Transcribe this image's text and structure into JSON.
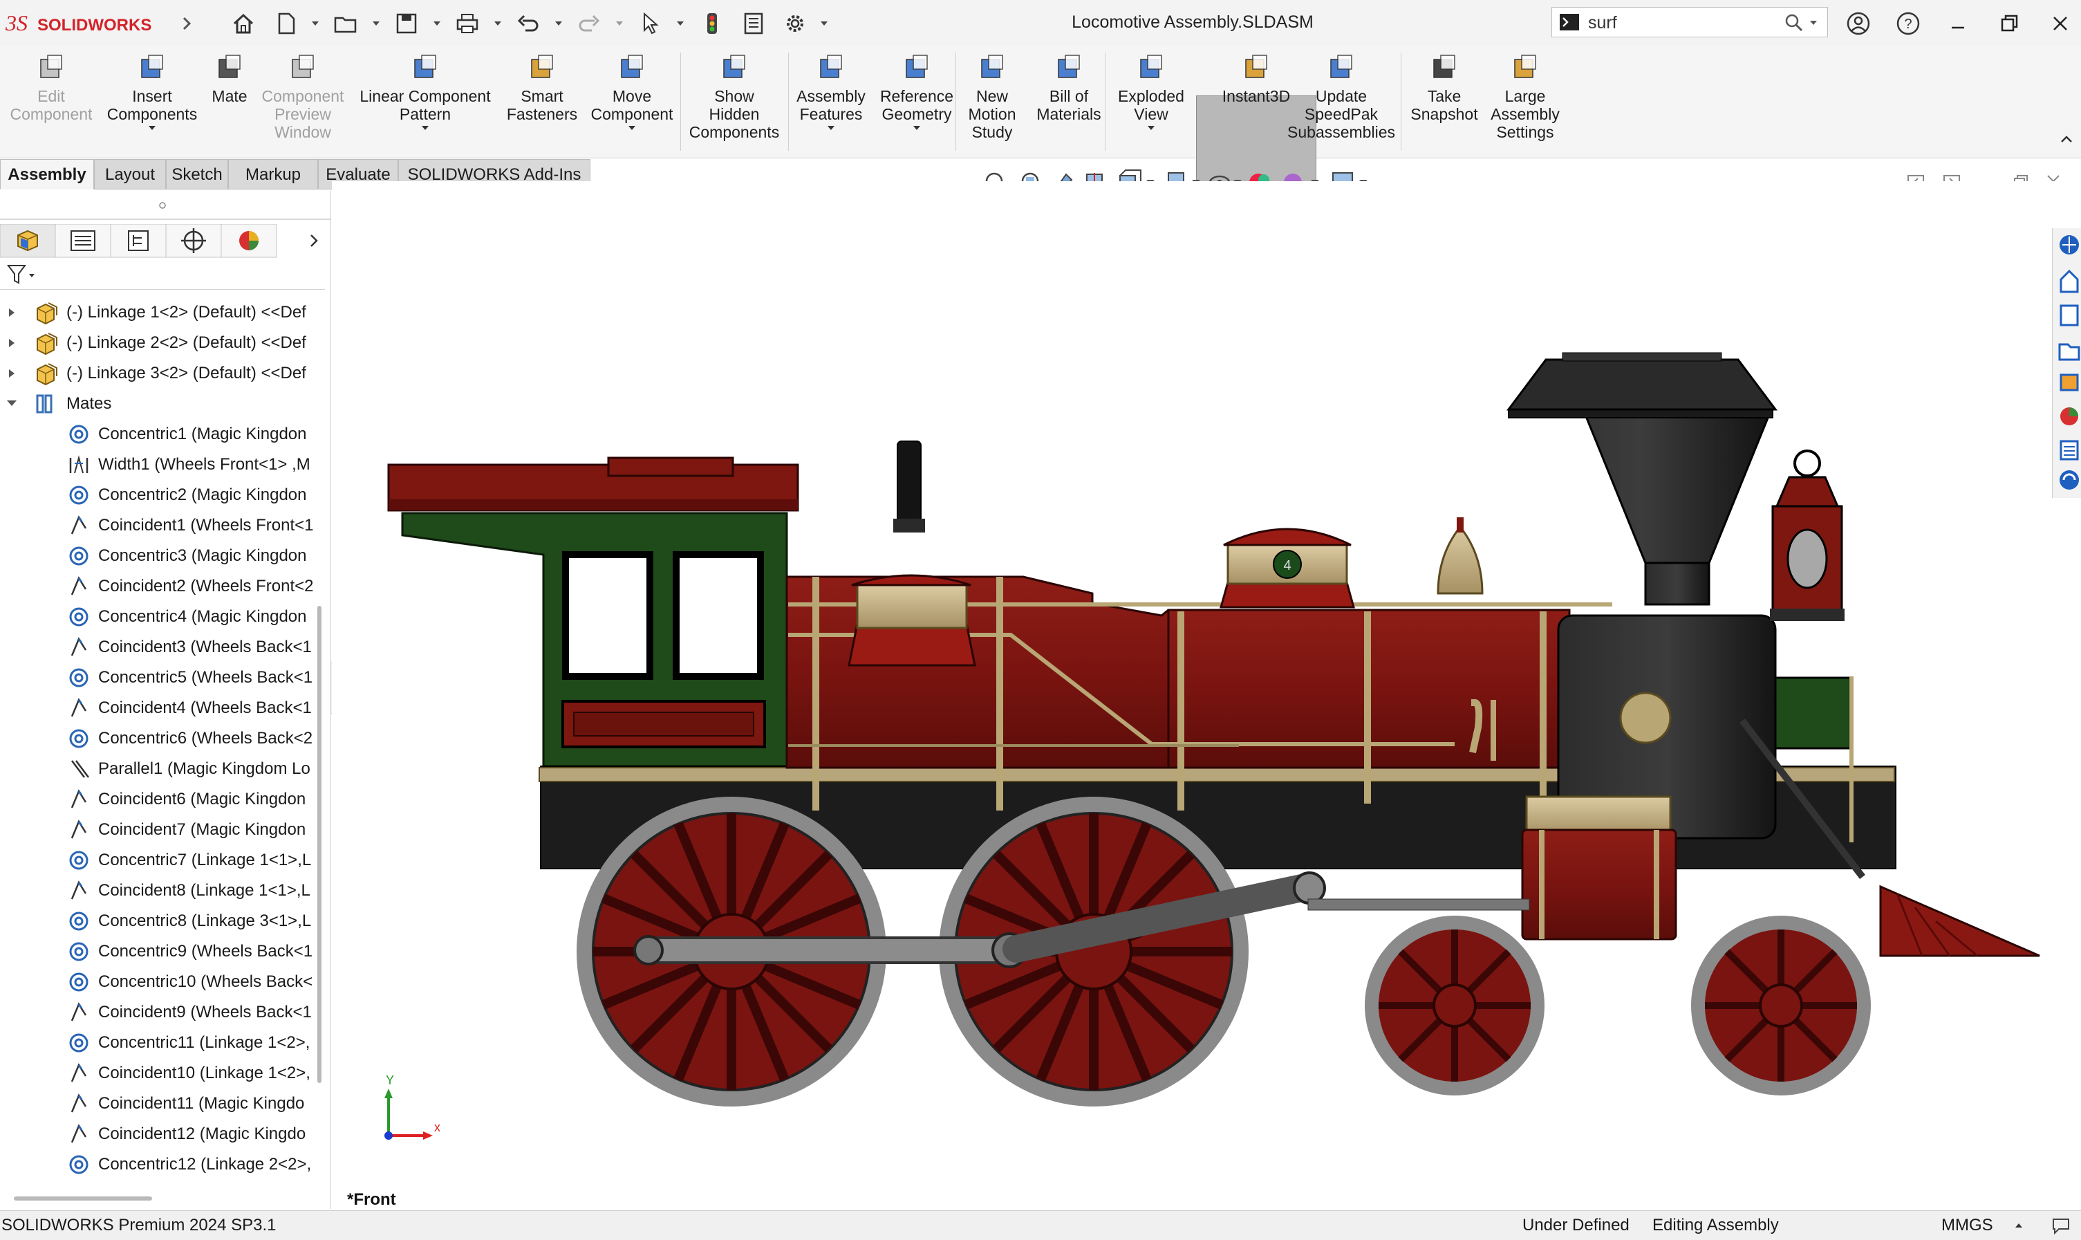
{
  "app": {
    "name": "SOLIDWORKS",
    "document_title": "Locomotive Assembly.SLDASM"
  },
  "search": {
    "value": "surf"
  },
  "commands": [
    {
      "id": "edit-component",
      "label": "Edit\nComponent",
      "disabled": true
    },
    {
      "id": "insert-components",
      "label": "Insert\nComponents"
    },
    {
      "id": "mate",
      "label": "Mate"
    },
    {
      "id": "component-preview-window",
      "label": "Component\nPreview\nWindow",
      "disabled": true
    },
    {
      "id": "linear-component-pattern",
      "label": "Linear Component\nPattern"
    },
    {
      "id": "smart-fasteners",
      "label": "Smart\nFasteners"
    },
    {
      "id": "move-component",
      "label": "Move\nComponent"
    },
    {
      "id": "show-hidden-components",
      "label": "Show\nHidden\nComponents"
    },
    {
      "id": "assembly-features",
      "label": "Assembly\nFeatures"
    },
    {
      "id": "reference-geometry",
      "label": "Reference\nGeometry"
    },
    {
      "id": "new-motion-study",
      "label": "New\nMotion\nStudy"
    },
    {
      "id": "bill-of-materials",
      "label": "Bill of\nMaterials"
    },
    {
      "id": "exploded-view",
      "label": "Exploded\nView"
    },
    {
      "id": "instant3d",
      "label": "Instant3D",
      "active": true
    },
    {
      "id": "update-speedpak",
      "label": "Update\nSpeedPak\nSubassemblies"
    },
    {
      "id": "take-snapshot",
      "label": "Take\nSnapshot"
    },
    {
      "id": "large-assembly-settings",
      "label": "Large\nAssembly\nSettings"
    }
  ],
  "tabs": [
    "Assembly",
    "Layout",
    "Sketch",
    "Markup",
    "Evaluate",
    "SOLIDWORKS Add-Ins"
  ],
  "active_tab": "Assembly",
  "tree": {
    "components": [
      "(-) Linkage 1<2> (Default) <<Def",
      "(-) Linkage 2<2> (Default) <<Def",
      "(-) Linkage 3<2> (Default) <<Def"
    ],
    "mates_folder": "Mates",
    "mates": [
      {
        "type": "concentric",
        "label": "Concentric1 (Magic Kingdon"
      },
      {
        "type": "width",
        "label": "Width1 (Wheels Front<1> ,M"
      },
      {
        "type": "concentric",
        "label": "Concentric2 (Magic Kingdon"
      },
      {
        "type": "coincident",
        "label": "Coincident1 (Wheels Front<1"
      },
      {
        "type": "concentric",
        "label": "Concentric3 (Magic Kingdon"
      },
      {
        "type": "coincident",
        "label": "Coincident2 (Wheels Front<2"
      },
      {
        "type": "concentric",
        "label": "Concentric4 (Magic Kingdon"
      },
      {
        "type": "coincident",
        "label": "Coincident3 (Wheels Back<1"
      },
      {
        "type": "concentric",
        "label": "Concentric5 (Wheels Back<1"
      },
      {
        "type": "coincident",
        "label": "Coincident4 (Wheels Back<1"
      },
      {
        "type": "concentric",
        "label": "Concentric6 (Wheels Back<2"
      },
      {
        "type": "parallel",
        "label": "Parallel1 (Magic Kingdom Lo"
      },
      {
        "type": "coincident",
        "label": "Coincident6 (Magic Kingdon"
      },
      {
        "type": "coincident",
        "label": "Coincident7 (Magic Kingdon"
      },
      {
        "type": "concentric",
        "label": "Concentric7 (Linkage 1<1>,L"
      },
      {
        "type": "coincident",
        "label": "Coincident8 (Linkage 1<1>,L"
      },
      {
        "type": "concentric",
        "label": "Concentric8 (Linkage 3<1>,L"
      },
      {
        "type": "concentric",
        "label": "Concentric9 (Wheels Back<1"
      },
      {
        "type": "concentric",
        "label": "Concentric10 (Wheels Back<"
      },
      {
        "type": "coincident",
        "label": "Coincident9 (Wheels Back<1"
      },
      {
        "type": "concentric",
        "label": "Concentric11 (Linkage 1<2>,"
      },
      {
        "type": "coincident",
        "label": "Coincident10 (Linkage 1<2>,"
      },
      {
        "type": "coincident",
        "label": "Coincident11 (Magic Kingdo"
      },
      {
        "type": "coincident",
        "label": "Coincident12 (Magic Kingdo"
      },
      {
        "type": "concentric",
        "label": "Concentric12 (Linkage 2<2>,"
      }
    ]
  },
  "viewport": {
    "view_name": "*Front",
    "triad": {
      "x": "x",
      "y": "Y"
    }
  },
  "status": {
    "version": "SOLIDWORKS Premium 2024 SP3.1",
    "definition": "Under Defined",
    "mode": "Editing Assembly",
    "units": "MMGS"
  },
  "colors": {
    "body_red": "#7a1410",
    "cab_green": "#1f4a1a",
    "brass": "#c8b48a",
    "black": "#1c1c1c",
    "highlight_bg": "#b8b8b8"
  }
}
